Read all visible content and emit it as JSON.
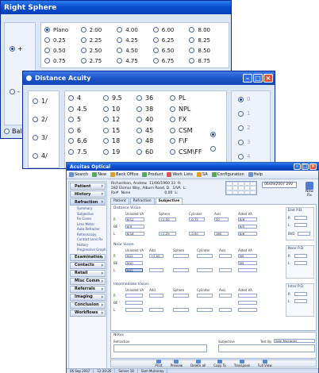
{
  "sphere_window": {
    "title": "Right Sphere",
    "sign_plus": "+",
    "sign_minus": "-",
    "bal_label": "Bal",
    "values": [
      [
        "Plano",
        "2.00",
        "4.00",
        "6.00",
        "8.00"
      ],
      [
        "0.25",
        "2.25",
        "4.25",
        "6.25",
        "8.25"
      ],
      [
        "0.50",
        "2.50",
        "4.50",
        "6.50",
        "8.50"
      ],
      [
        "0.75",
        "2.75",
        "4.75",
        "6.75",
        "8.75"
      ]
    ]
  },
  "acuity_window": {
    "title": "Distance Acuity",
    "left_options": [
      "1/",
      "2/",
      "3/",
      "4/"
    ],
    "grid": [
      [
        "4",
        "9.5",
        "36",
        "PL"
      ],
      [
        "4.5",
        "10",
        "38",
        "NPL"
      ],
      [
        "5",
        "12",
        "40",
        "FX"
      ],
      [
        "6",
        "15",
        "45",
        "CSM"
      ],
      [
        "6.6",
        "18",
        "48",
        "F\\F"
      ],
      [
        "7.5",
        "19",
        "60",
        "CSM\\FF"
      ]
    ],
    "right_options": [
      "0",
      "1",
      "2",
      "3",
      "4"
    ]
  },
  "main_window": {
    "title": "Acuitas Optical",
    "toolbar": [
      {
        "icon": "search-icon",
        "label": "Search"
      },
      {
        "icon": "new-icon",
        "label": "New"
      },
      {
        "icon": "back-office-icon",
        "label": "Back Office"
      },
      {
        "icon": "product-icon",
        "label": "Product"
      },
      {
        "icon": "work-lists-icon",
        "label": "Work Lists"
      },
      {
        "icon": "sa-icon",
        "label": "SA"
      },
      {
        "icon": "configuration-icon",
        "label": "Configuration"
      },
      {
        "icon": "help-icon",
        "label": "Help"
      }
    ],
    "sidebar": [
      {
        "label": "Patient",
        "open": false
      },
      {
        "label": "History",
        "open": false
      },
      {
        "label": "Refraction",
        "open": true,
        "items": [
          "Summary",
          "Subjective",
          "Rx Given",
          "Lens Meter",
          "Auto Refractor",
          "Retinoscopy",
          "Contact Lens Rx",
          "History",
          "Progressive Graph"
        ]
      },
      {
        "label": "Examination",
        "open": false
      },
      {
        "label": "Contacts",
        "open": false
      },
      {
        "label": "Retail",
        "open": false
      },
      {
        "label": "Misc Comm",
        "open": false
      },
      {
        "label": "Referrals",
        "open": false
      },
      {
        "label": "Imaging",
        "open": false
      },
      {
        "label": "Conclusion",
        "open": false
      },
      {
        "label": "Workflows",
        "open": false
      }
    ],
    "patient": {
      "line1": "Richardson, Andrew",
      "line1_dob": "11/06/1960  33",
      "line1_r": "R:",
      "line2": "282 Elsmar Way, Alburn Road, D.",
      "line2_va": "1/VA",
      "line2_l": "L:",
      "line3_label": "Rx#",
      "line3_val": "None",
      "line3_d": "0.00",
      "line3_l": "L:"
    },
    "date": "06/09/2007 29V",
    "new_rx": "New Rx",
    "tabs": [
      "Patient",
      "Refraction",
      "Subjective"
    ],
    "distance_vision": {
      "title": "Distance Vision",
      "headers": [
        "Unaided VA",
        "Sphere",
        "Cylinder",
        "Axis",
        "Aided VA"
      ],
      "r": [
        "6/12",
        "+2.50",
        "-0.75",
        "20",
        "6/6"
      ],
      "be": [
        "6/9",
        "",
        "",
        "",
        "6/5"
      ],
      "l": [
        "6/18",
        "+2.25",
        "-0.50",
        "160",
        "6/6"
      ]
    },
    "near_vision": {
      "title": "Near Vision",
      "headers": [
        "Unaided VA",
        "Add",
        "Sphere",
        "Cylinder",
        "Axis",
        "Aided VA"
      ],
      "r": [
        "N12",
        "+2.00",
        "",
        "",
        "",
        "N5"
      ],
      "be": [
        "N10",
        "",
        "",
        "",
        "",
        "N5"
      ],
      "l": [
        "N12",
        "",
        "",
        "",
        "",
        ""
      ]
    },
    "intermediate_vision": {
      "title": "Intermediate Vision",
      "headers": [
        "Unaided VA",
        "Add",
        "Sphere",
        "Cylinder",
        "Axis",
        "Aided VA"
      ]
    },
    "row_labels": [
      "R",
      "BE",
      "L"
    ],
    "side_boxes": [
      "Dist P.D.",
      "Near P.D.",
      "Inter P.D."
    ],
    "side_bvd": "BVD",
    "notes": {
      "title": "Notes",
      "refraction_label": "Refraction",
      "subjective_label": "Subjective",
      "test_by_label": "Test By",
      "test_by_value": "Sam Mulroney"
    },
    "bottom_buttons": [
      "Print",
      "Preview",
      "Delete all",
      "Copy To",
      "Transpose",
      "Full View"
    ],
    "status": [
      "06 Sep 2007",
      "12:30:26",
      "Server 18",
      "Sam Mulroney"
    ]
  }
}
